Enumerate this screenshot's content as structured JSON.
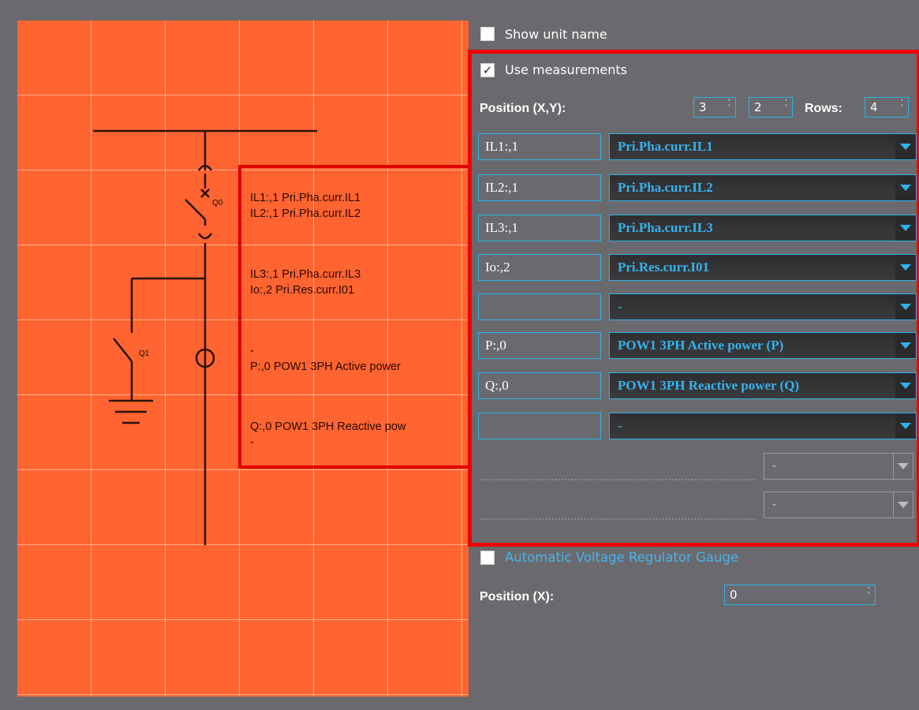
{
  "diagram": {
    "q0_label": "Q0",
    "q1_label": "Q1",
    "measurement_lines": [
      "IL1:,1 Pri.Pha.curr.IL1",
      "IL2:,1 Pri.Pha.curr.IL2",
      "IL3:,1 Pri.Pha.curr.IL3",
      "Io:,2 Pri.Res.curr.I01",
      "-",
      "P:,0 POW1 3PH Active power",
      "Q:,0 POW1 3PH Reactive pow",
      "-"
    ]
  },
  "panel": {
    "show_unit_name": {
      "label": "Show unit name",
      "checked": false
    },
    "use_measurements": {
      "label": "Use measurements",
      "checked": true,
      "check_glyph": "✓"
    },
    "position_label": "Position (X,Y):",
    "position_x": "3",
    "position_y": "2",
    "rows_label": "Rows:",
    "rows_value": "4",
    "spin_arrows": "⁚",
    "rows": [
      {
        "label": "IL1:,1",
        "value": "Pri.Pha.curr.IL1"
      },
      {
        "label": "IL2:,1",
        "value": "Pri.Pha.curr.IL2"
      },
      {
        "label": "IL3:,1",
        "value": "Pri.Pha.curr.IL3"
      },
      {
        "label": "Io:,2",
        "value": "Pri.Res.curr.I01"
      },
      {
        "label": "",
        "value": "-"
      },
      {
        "label": "P:,0",
        "value": "POW1 3PH Active power (P)"
      },
      {
        "label": "Q:,0",
        "value": "POW1 3PH Reactive power (Q)"
      },
      {
        "label": "",
        "value": "-"
      }
    ],
    "extra_selects": [
      "-",
      "-"
    ],
    "avr_gauge": {
      "label": "Automatic Voltage Regulator Gauge",
      "checked": false
    },
    "position_x_label": "Position (X):",
    "position_x_value": "0"
  },
  "colors": {
    "canvas": "#ff6431",
    "panel_bg": "#6a6a6e",
    "highlight": "#e00000",
    "accent": "#2fb2e8",
    "select_text": "#36b3ee"
  }
}
